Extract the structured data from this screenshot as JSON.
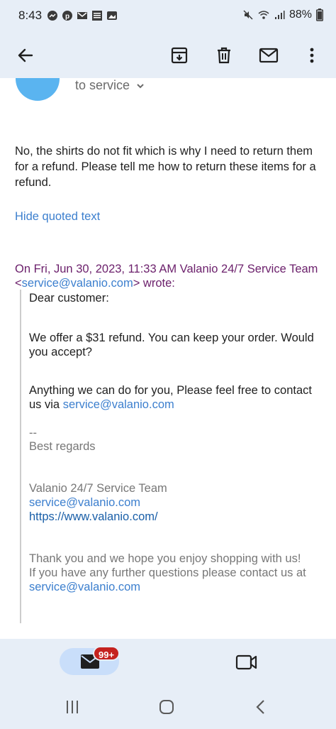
{
  "status_bar": {
    "time": "8:43",
    "battery": "88%",
    "left_icons": [
      "messenger-icon",
      "pinterest-icon",
      "gmail-icon",
      "weather-channel-icon",
      "gallery-icon"
    ],
    "right_icons": [
      "mute-icon",
      "wifi-icon",
      "signal-icon"
    ]
  },
  "app_bar": {
    "icons": [
      "back-arrow-icon",
      "archive-icon",
      "trash-icon",
      "mark-unread-icon",
      "more-vert-icon"
    ]
  },
  "email": {
    "recipient": "to service",
    "body": "No, the shirts do not fit which is why I need to return them for a refund.  Please tell me how to return these items for a refund.",
    "hide_quoted": "Hide quoted text",
    "quote_header_prefix": "On Fri, Jun 30, 2023, 11:33 AM Valanio 24/7 Service Team <",
    "quote_header_email": "service@valanio.com",
    "quote_header_suffix": "> wrote:",
    "quoted": {
      "greeting": "Dear customer:",
      "offer": "We offer a $31 refund. You can keep your order. Would you accept?",
      "contact_text": "Anything we can do for you, Please feel free to contact us via ",
      "contact_email": "service@valanio.com",
      "dashes": "--",
      "regards": "Best regards",
      "team": "Valanio 24/7 Service Team",
      "team_email": "service@valanio.com",
      "website": "https://www.valanio.com/",
      "thanks": "Thank you and we hope you enjoy shopping with us!",
      "further": "If you have any further questions please contact us at",
      "further_email": "service@valanio.com"
    }
  },
  "bottom_nav": {
    "mail_badge": "99+",
    "icons": [
      "mail-icon",
      "video-icon"
    ]
  },
  "system_nav": {
    "icons": [
      "recents-icon",
      "home-icon",
      "back-icon"
    ]
  },
  "colors": {
    "accent": "#3c7fce",
    "header_purple": "#6b1f6b",
    "badge_red": "#c5221f",
    "bar_bg": "#e7eef7"
  }
}
